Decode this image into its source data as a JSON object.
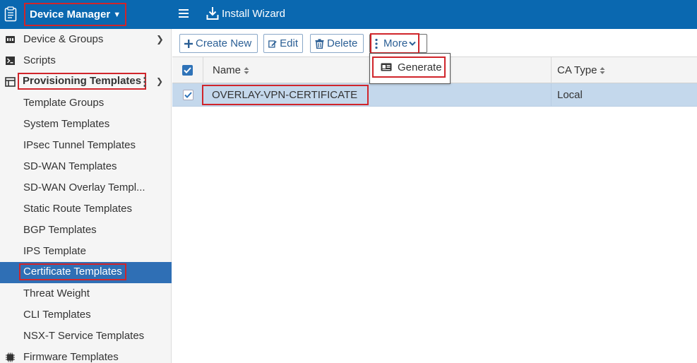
{
  "header": {
    "app_title": "Device Manager",
    "wizard_label": "Install Wizard",
    "brand_color": "#0a68b0"
  },
  "sidebar": {
    "items": [
      {
        "label": "Device & Groups",
        "icon": "device-groups-icon"
      },
      {
        "label": "Scripts",
        "icon": "script-icon"
      },
      {
        "label": "Provisioning Templates",
        "icon": "template-icon"
      },
      {
        "label": "Template Groups"
      },
      {
        "label": "System Templates"
      },
      {
        "label": "IPsec Tunnel Templates"
      },
      {
        "label": "SD-WAN Templates"
      },
      {
        "label": "SD-WAN Overlay Templ..."
      },
      {
        "label": "Static Route Templates"
      },
      {
        "label": "BGP Templates"
      },
      {
        "label": "IPS Template"
      },
      {
        "label": "Certificate Templates"
      },
      {
        "label": "Threat Weight"
      },
      {
        "label": "CLI Templates"
      },
      {
        "label": "NSX-T Service Templates"
      },
      {
        "label": "Firmware Templates",
        "icon": "chip-icon"
      }
    ],
    "active_item": "Certificate Templates",
    "active_color": "#2f6fb5"
  },
  "toolbar": {
    "create_label": "Create New",
    "edit_label": "Edit",
    "delete_label": "Delete",
    "more_label": "More"
  },
  "more_menu": {
    "generate_label": "Generate"
  },
  "table": {
    "columns": [
      "Name",
      "CA Type"
    ],
    "rows": [
      {
        "name": "OVERLAY-VPN-CERTIFICATE",
        "ca_type": "Local",
        "selected": true
      }
    ]
  },
  "highlight_color": "#d0252b"
}
